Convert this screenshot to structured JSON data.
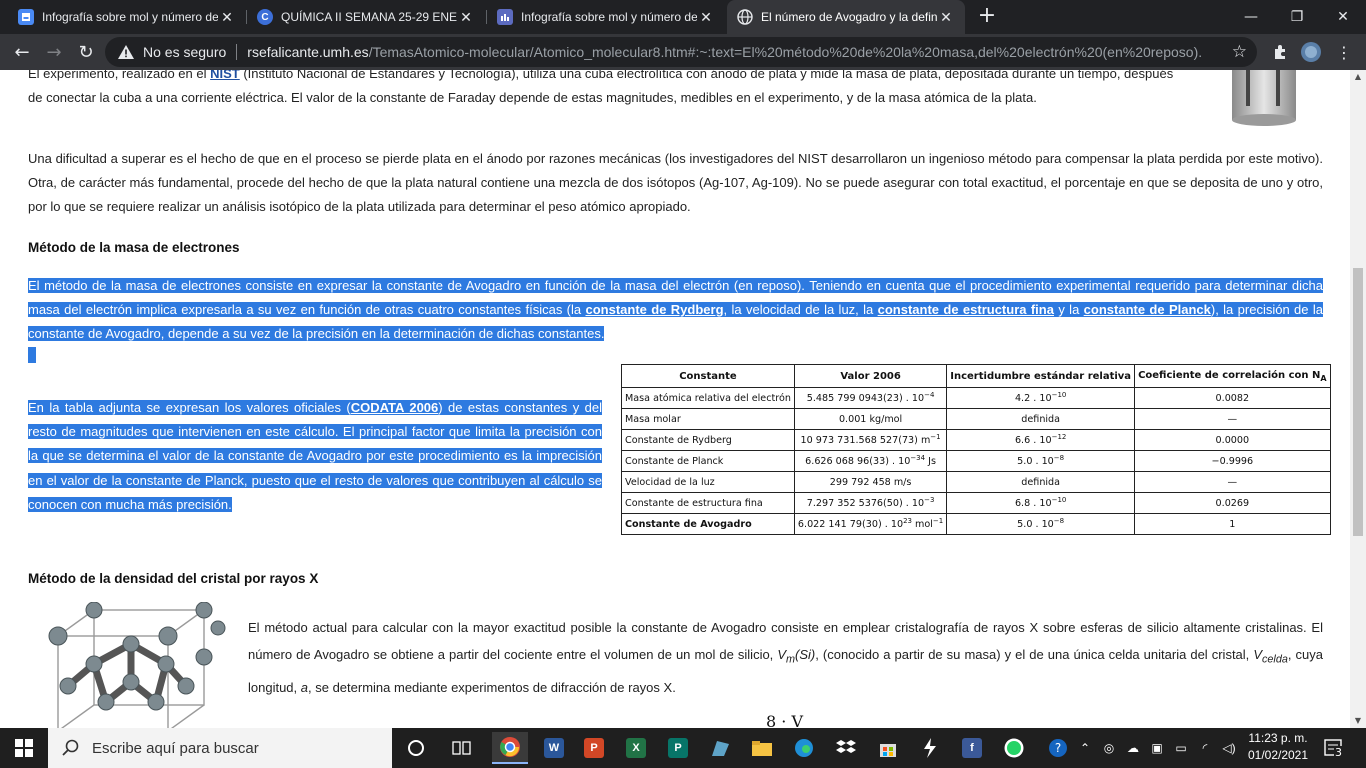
{
  "browser": {
    "tabs": [
      {
        "title": "Infografía sobre mol y número de",
        "icon": "doc-icon",
        "color": "#4a8af4",
        "active": false
      },
      {
        "title": "QUÍMICA II SEMANA 25-29 ENE",
        "icon": "c-circle-icon",
        "color": "#3c6fd8",
        "active": false
      },
      {
        "title": "Infografía sobre mol y número de",
        "icon": "bar-icon",
        "color": "#5c6bc0",
        "active": false
      },
      {
        "title": "El número de Avogadro y la defin",
        "icon": "globe-icon",
        "color": "#e8eaed",
        "active": true
      }
    ],
    "address": {
      "security_label": "No es seguro",
      "host": "rsefalicante.umh.es",
      "path": "/TemasAtomico-molecular/Atomico_molecular8.htm#:~:text=El%20método%20de%20la%20masa,del%20electrón%20(en%20reposo)."
    }
  },
  "page": {
    "para0": {
      "line1_a": "El experimento, realizado en el ",
      "line1_link": "NIST",
      "line1_b": " (Instituto Nacional de Estándares y Tecnología), utiliza una cuba electrolítica  con ánodo de plata y mide la masa de plata, depositada durante un tiempo, después",
      "line2": "de conectar la cuba a una corriente eléctrica. El valor de la constante de Faraday depende de estas magnitudes, medibles en el experimento, y de la masa atómica de la plata."
    },
    "para1": "Una dificultad a superar es el hecho de que en el proceso se pierde plata en el ánodo por razones mecánicas (los investigadores del NIST desarrollaron un ingenioso método para compensar la plata perdida por este motivo). Otra, de carácter más fundamental, procede del hecho de que la plata natural contiene una mezcla de dos isótopos (Ag-107, Ag-109). No se puede asegurar con total exactitud, el porcentaje en que se deposita de uno y otro, por lo que se requiere realizar un análisis isotópico de la plata utilizada para determinar el peso atómico apropiado.",
    "heading1": "Método de la masa de electrones",
    "para2": {
      "a": "El método de la masa de electrones consiste en expresar la constante de Avogadro en función de la masa del electrón (en reposo). Teniendo en cuenta que el procedimiento experimental requerido para determinar dicha masa del electrón implica expresarla a su vez en función de otras cuatro constantes físicas (la ",
      "link1": "constante de Rydberg",
      "b": ", la velocidad de la luz, la ",
      "link2": "constante de estructura fina",
      "c": " y la ",
      "link3": "constante de Planck",
      "d": "), la precisión de la constante de Avogadro, depende a su vez de la precisión en la determinación de dichas constantes."
    },
    "para3": {
      "a": "En la tabla adjunta se expresan los valores oficiales (",
      "link": "CODATA 2006",
      "b": ") de estas constantes y del resto de magnitudes que intervienen en este cálculo. El principal factor que limita la precisión con la que se determina el valor de la constante de Avogadro por este procedimiento es la imprecisión en el valor de la constante de Planck, puesto que el resto de valores que contribuyen al cálculo se conocen con mucha más precisión."
    },
    "table": {
      "headers": [
        "Constante",
        "Valor 2006",
        "Incertidumbre estándar relativa",
        "Coeficiente de correlación con N",
        "A"
      ],
      "rows": [
        {
          "name": "Masa atómica relativa del electrón",
          "value": "5.485 799 0943(23) . 10",
          "value_sup": "−4",
          "value_suffix": "",
          "unc": "4.2 . 10",
          "unc_sup": "−10",
          "corr": "0.0082"
        },
        {
          "name": "Masa molar",
          "value": "0.001 kg/mol",
          "value_sup": "",
          "value_suffix": "",
          "unc": "definida",
          "unc_sup": "",
          "corr": "—"
        },
        {
          "name": "Constante de Rydberg",
          "value": "10 973 731.568 527(73) m",
          "value_sup": "−1",
          "value_suffix": "",
          "unc": "6.6 . 10",
          "unc_sup": "−12",
          "corr": "0.0000"
        },
        {
          "name": "Constante de Planck",
          "value": "6.626 068 96(33) . 10",
          "value_sup": "−34",
          "value_suffix": " Js",
          "unc": "5.0 . 10",
          "unc_sup": "−8",
          "corr": "−0.9996"
        },
        {
          "name": "Velocidad de la luz",
          "value": "299 792 458 m/s",
          "value_sup": "",
          "value_suffix": "",
          "unc": "definida",
          "unc_sup": "",
          "corr": "—"
        },
        {
          "name": "Constante de estructura fina",
          "value": "7.297 352 5376(50) . 10",
          "value_sup": "−3",
          "value_suffix": "",
          "unc": "6.8 . 10",
          "unc_sup": "−10",
          "corr": "0.0269"
        },
        {
          "name": "Constante de Avogadro",
          "value": "6.022 141 79(30) . 10",
          "value_sup": "23",
          "value_suffix": " mol",
          "value_sup2": "−1",
          "unc": "5.0 . 10",
          "unc_sup": "−8",
          "corr": "1"
        }
      ]
    },
    "heading2": "Método de la densidad del cristal por rayos X",
    "para4": {
      "a": "El método actual para calcular con la mayor exactitud posible la constante de Avogadro consiste en emplear cristalografía de rayos X sobre esferas de silicio altamente cristalinas. El número de Avogadro se obtiene a partir del cociente entre el volumen de un mol de silicio, ",
      "v1": "V",
      "v1_sub": "m",
      "v1_arg": "(Si)",
      "b": ", (conocido a partir de su masa) y el de una única celda unitaria del cristal, ",
      "v2": "V",
      "v2_sub": "celda",
      "c": ", cuya longitud, ",
      "a_var": "a",
      "d": ", se determina mediante experimentos de difracción de rayos X."
    },
    "formula": "8 · V"
  },
  "taskbar": {
    "search_placeholder": "Escribe aquí para buscar",
    "time": "11:23 p. m.",
    "date": "01/02/2021",
    "notification_count": "3"
  }
}
